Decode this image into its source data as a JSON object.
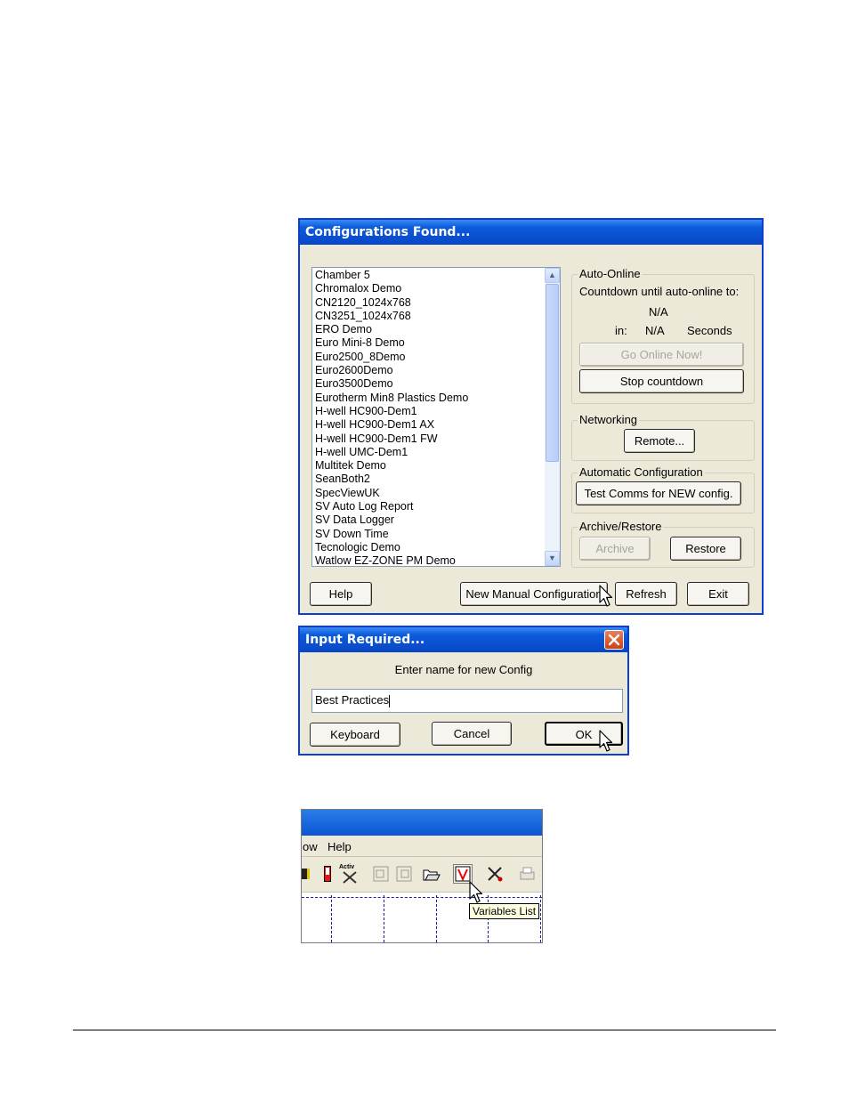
{
  "config_dialog": {
    "title": "Configurations Found...",
    "configurations": [
      "Chamber 5",
      "Chromalox Demo",
      "CN2120_1024x768",
      "CN3251_1024x768",
      "ERO Demo",
      "Euro Mini-8 Demo",
      "Euro2500_8Demo",
      "Euro2600Demo",
      "Euro3500Demo",
      "Eurotherm Min8 Plastics Demo",
      "H-well HC900-Dem1",
      "H-well HC900-Dem1 AX",
      "H-well HC900-Dem1 FW",
      "H-well UMC-Dem1",
      "Multitek Demo",
      "SeanBoth2",
      "SpecViewUK",
      "SV Auto Log Report",
      "SV Data Logger",
      "SV Down Time",
      "Tecnologic Demo",
      "Watlow EZ-ZONE PM Demo"
    ],
    "auto_online": {
      "label": "Auto-Online",
      "countdown_text": "Countdown until auto-online to:",
      "target": "N/A",
      "in_label": "in:",
      "seconds_value": "N/A",
      "seconds_label": "Seconds",
      "go_online_label": "Go Online Now!",
      "stop_countdown_label": "Stop countdown"
    },
    "networking": {
      "label": "Networking",
      "remote_label": "Remote..."
    },
    "automatic_configuration": {
      "label": "Automatic Configuration",
      "test_comms_label": "Test Comms for NEW config."
    },
    "archive_restore": {
      "label": "Archive/Restore",
      "archive_label": "Archive",
      "restore_label": "Restore"
    },
    "buttons": {
      "help": "Help",
      "new_manual": "New Manual Configuration",
      "refresh": "Refresh",
      "exit": "Exit"
    }
  },
  "input_dialog": {
    "title": "Input Required...",
    "prompt": "Enter name for new Config",
    "value": "Best Practices",
    "keyboard_label": "Keyboard",
    "cancel_label": "Cancel",
    "ok_label": "OK"
  },
  "toolbar_snippet": {
    "menu_items": [
      "ow",
      "Help"
    ],
    "activ_label": "Activ",
    "tooltip": "Variables List"
  },
  "colors": {
    "xp_title_blue": "#0a4fd0",
    "dialog_face": "#ece9d8",
    "close_red": "#e0512c"
  }
}
